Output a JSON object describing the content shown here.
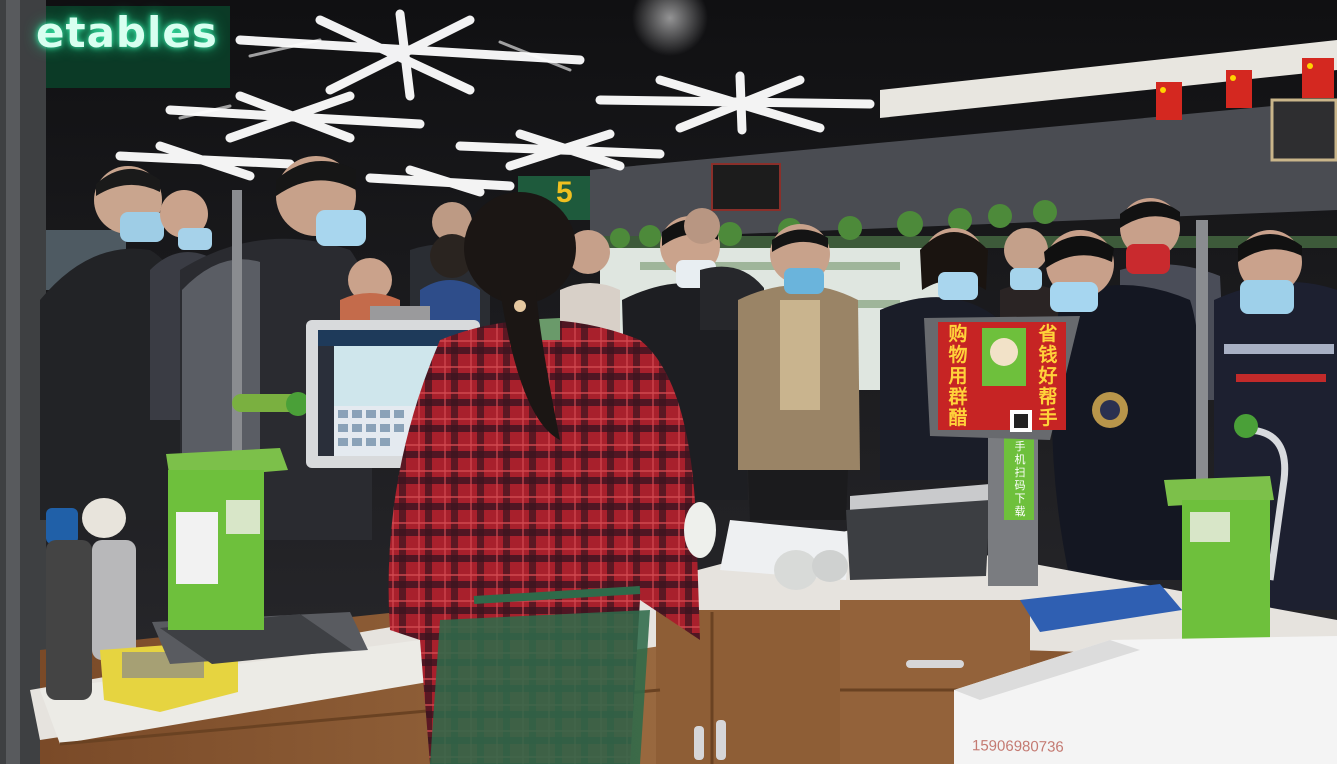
{
  "signage": {
    "neon_sign": "etables",
    "aisle_number": "5",
    "scale_slogan_left": "购物用群醋",
    "scale_slogan_right": "省钱好帮手",
    "scale_scan_label": "手机扫码下载",
    "box_phone_number": "15906980736"
  },
  "colors": {
    "neon": "#3cf0b0",
    "scale_green": "#6fc23a",
    "shirt_red": "#b0232e",
    "ceiling": "#1b1b1d",
    "counter_top": "#e9e6e1",
    "cabinet_wood": "#8a5a33"
  }
}
